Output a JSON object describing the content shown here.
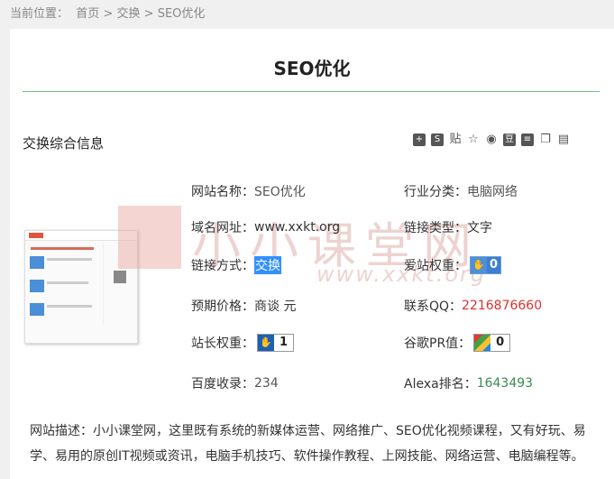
{
  "breadcrumb": {
    "prefix": "当前位置：",
    "home": "首页",
    "sep1": ">",
    "category": "交换",
    "sep2": ">",
    "current": "SEO优化"
  },
  "page_title": "SEO优化",
  "section_title": "交换综合信息",
  "share_icons": [
    "add-icon",
    "baidu-icon",
    "tieba-icon",
    "star-icon",
    "weibo-icon",
    "douban-icon",
    "note-icon",
    "copy-icon",
    "print-icon"
  ],
  "watermark": {
    "text": "小小课堂网",
    "url": "www.xxkt.org"
  },
  "fields": {
    "site_name": {
      "label": "网站名称：",
      "value": "SEO优化"
    },
    "industry": {
      "label": "行业分类：",
      "value": "电脑网络"
    },
    "domain": {
      "label": "域名网址：",
      "value": "www.xxkt.org"
    },
    "link_type": {
      "label": "链接类型：",
      "value": "文字"
    },
    "link_method": {
      "label": "链接方式：",
      "value": "交换"
    },
    "aizhan": {
      "label": "爱站权重：",
      "value": "0"
    },
    "price": {
      "label": "预期价格：",
      "value": "商谈 元"
    },
    "qq": {
      "label": "联系QQ：",
      "value": "2216876660"
    },
    "webmaster": {
      "label": "站长权重：",
      "value": "1"
    },
    "google_pr": {
      "label": "谷歌PR值：",
      "value": "0"
    },
    "baidu_index": {
      "label": "百度收录：",
      "value": "234"
    },
    "alexa": {
      "label": "Alexa排名：",
      "value": "1643493"
    }
  },
  "description": {
    "label": "网站描述：",
    "text": "小小课堂网，这里既有系统的新媒体运营、网络推广、SEO优化视频课程，又有好玩、易学、易用的原创IT视频或资讯，电脑手机技巧、软件操作教程、上网技能、网络运营、电脑编程等。"
  }
}
